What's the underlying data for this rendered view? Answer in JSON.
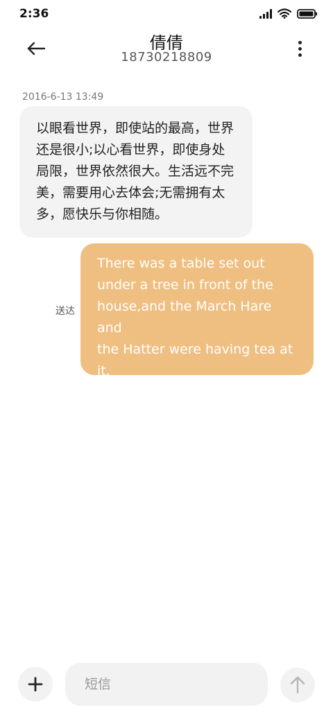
{
  "status_bar": {
    "time": "2:36",
    "icons": [
      "signal-icon",
      "wifi-icon",
      "battery-icon"
    ]
  },
  "header": {
    "contact_name": "倩倩",
    "phone_number": "18730218809",
    "back_icon": "back-arrow-icon",
    "more_icon": "more-vertical-icon"
  },
  "conversation": {
    "timestamp": "2016-6-13 13:49",
    "messages": [
      {
        "direction": "incoming",
        "lines": [
          "以眼看世界，即使站的最高，世界",
          "还是很小;以心看世界，即使身处",
          "局限，世界依然很大。生活远不完",
          "美，需要用心去体会;无需拥有太",
          "多，愿快乐与你相随。"
        ]
      },
      {
        "direction": "outgoing",
        "status": "送达",
        "lines": [
          "There was a table set out",
          "under a tree in front of the",
          "house,and the March Hare and",
          "the Hatter were having tea at",
          "it."
        ]
      }
    ]
  },
  "composer": {
    "placeholder": "短信",
    "add_icon": "plus-icon",
    "send_icon": "arrow-up-icon"
  },
  "colors": {
    "incoming_bubble": "#f3f3f3",
    "outgoing_bubble": "#efbf82",
    "background": "#ffffff"
  }
}
